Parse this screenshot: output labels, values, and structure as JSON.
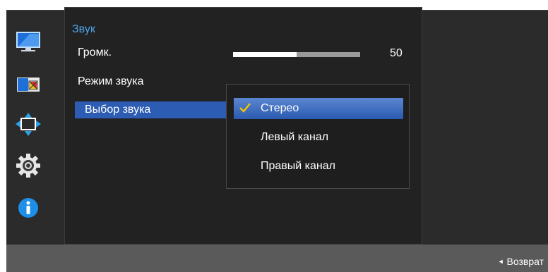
{
  "sidebar": {
    "icons": [
      "monitor-picture-icon",
      "color-icon",
      "position-icon",
      "settings-gear-icon",
      "information-icon"
    ]
  },
  "menu": {
    "title": "Звук",
    "items": [
      {
        "label": "Громк.",
        "value": "50",
        "level": 0.5
      },
      {
        "label": "Режим звука"
      },
      {
        "label": "Выбор звука",
        "selected": true
      }
    ]
  },
  "dropdown": {
    "options": [
      {
        "label": "Стерео",
        "selected": true
      },
      {
        "label": "Левый канал"
      },
      {
        "label": "Правый канал"
      }
    ]
  },
  "footer": {
    "back_label": "Возврат"
  },
  "colors": {
    "accent": "#2c5cb3",
    "title_blue": "#4da3e6",
    "check": "#f5c400"
  }
}
